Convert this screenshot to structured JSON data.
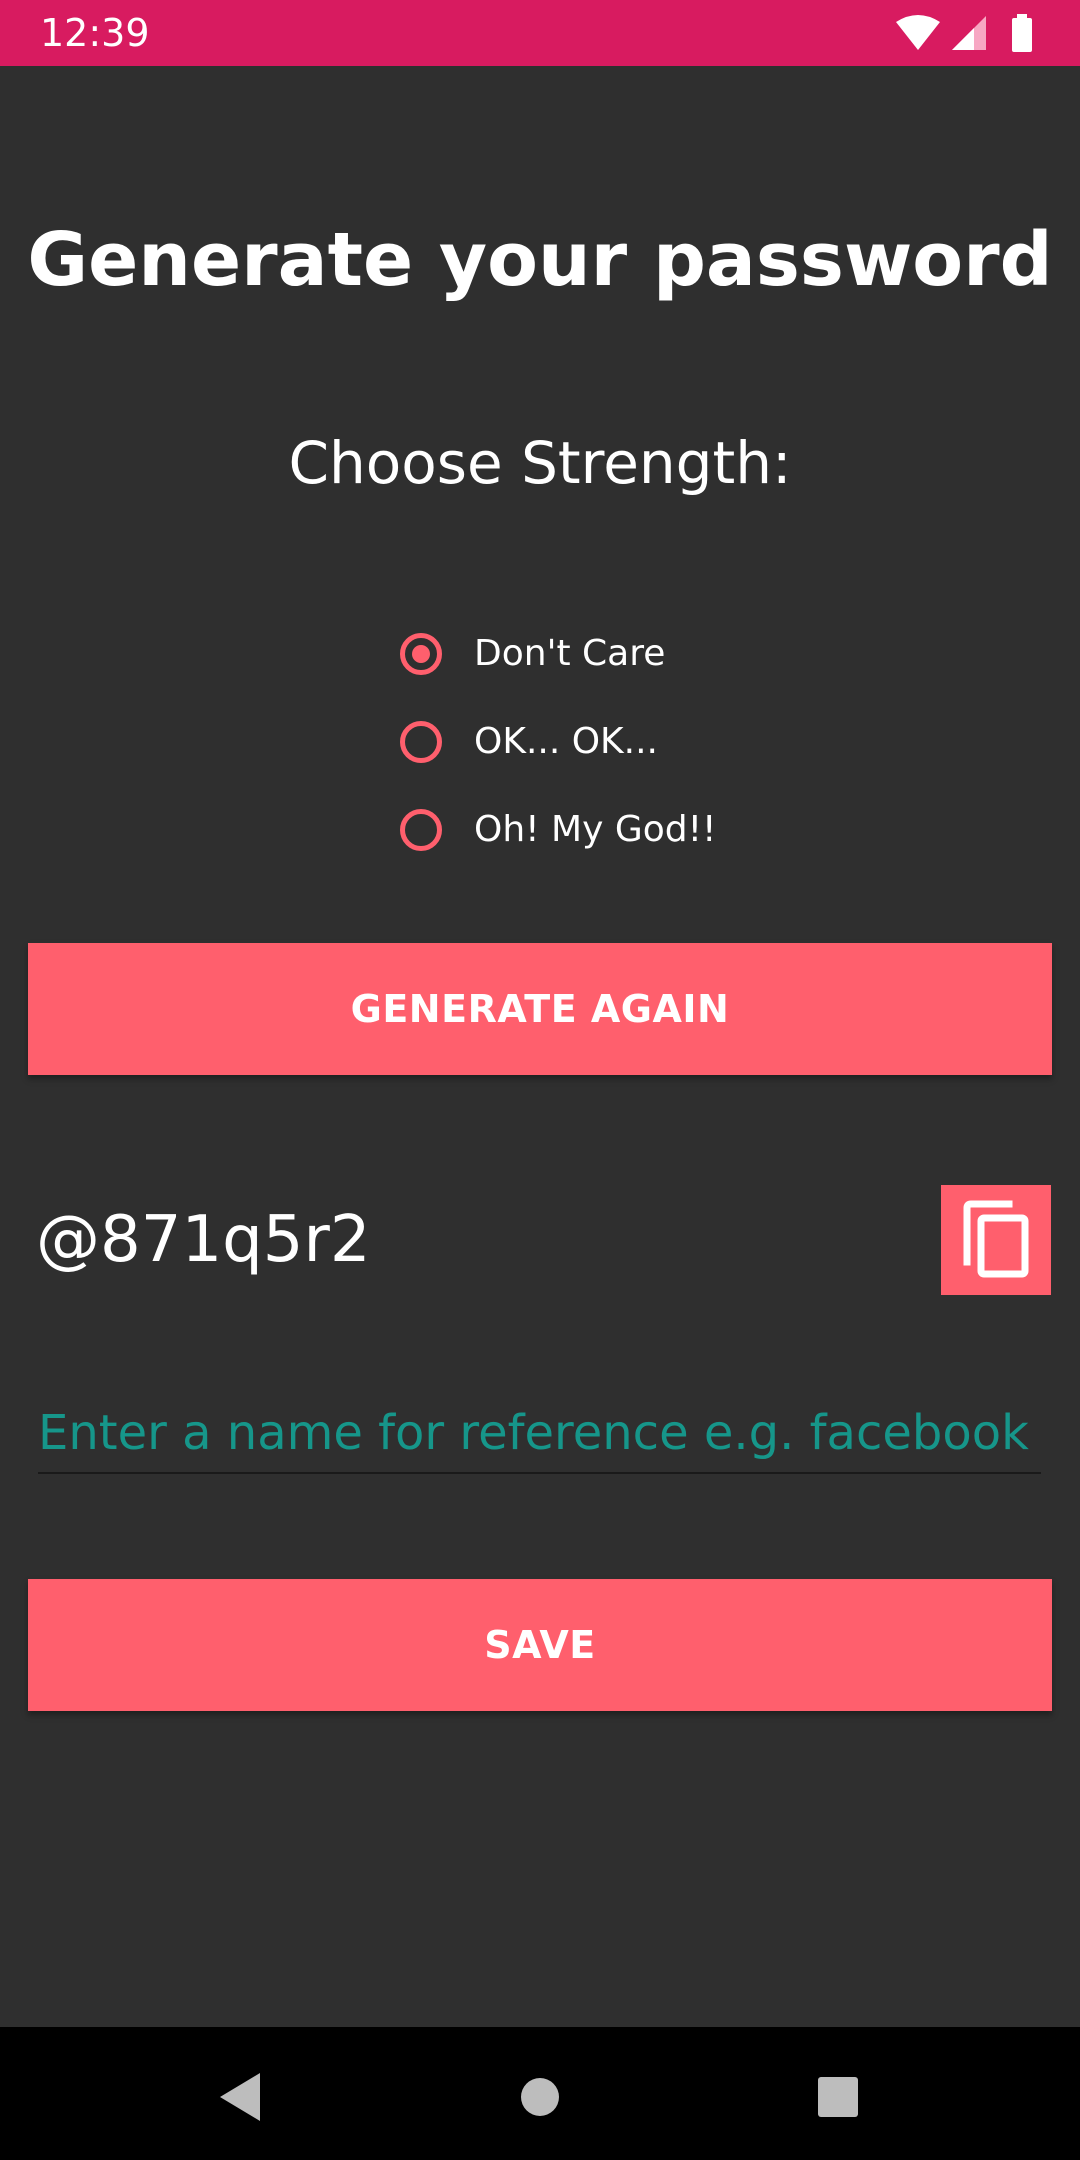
{
  "status_bar": {
    "time": "12:39",
    "icons": [
      "wifi-icon",
      "signal-icon",
      "battery-icon"
    ],
    "color": "#d81b60"
  },
  "title": "Generate your password",
  "subtitle": "Choose Strength:",
  "strength_options": [
    {
      "label": "Don't Care",
      "selected": true
    },
    {
      "label": "OK... OK...",
      "selected": false
    },
    {
      "label": "Oh! My God!!",
      "selected": false
    }
  ],
  "generate_button": {
    "label": "GENERATE AGAIN"
  },
  "password": {
    "value": "@871q5r2",
    "copy_icon": "copy-icon"
  },
  "reference_input": {
    "value": "",
    "placeholder": "Enter a name for reference e.g. facebook"
  },
  "save_button": {
    "label": "SAVE"
  },
  "nav_bar": {
    "icons": [
      "back-icon",
      "home-icon",
      "recents-icon"
    ]
  },
  "colors": {
    "accent": "#ff5f6d",
    "background": "#2f2f2f",
    "status_bar": "#d81b60",
    "hint": "#16968a"
  }
}
